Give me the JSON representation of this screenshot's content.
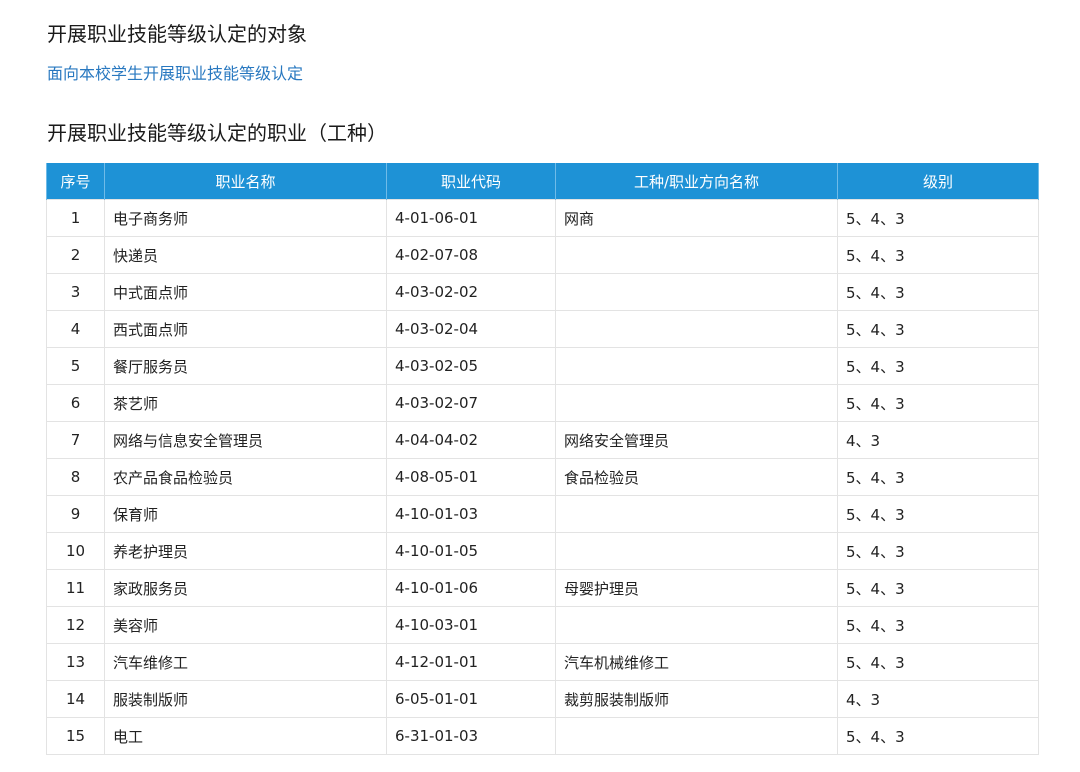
{
  "section1": {
    "title": "开展职业技能等级认定的对象",
    "link_text": "面向本校学生开展职业技能等级认定"
  },
  "section2": {
    "title": "开展职业技能等级认定的职业（工种）"
  },
  "table": {
    "header_bg": "#1e92d6",
    "headers": [
      "序号",
      "职业名称",
      "职业代码",
      "工种/职业方向名称",
      "级别"
    ],
    "rows": [
      [
        "1",
        "电子商务师",
        "4-01-06-01",
        "网商",
        "5、4、3"
      ],
      [
        "2",
        "快递员",
        "4-02-07-08",
        "",
        "5、4、3"
      ],
      [
        "3",
        "中式面点师",
        "4-03-02-02",
        "",
        "5、4、3"
      ],
      [
        "4",
        "西式面点师",
        "4-03-02-04",
        "",
        "5、4、3"
      ],
      [
        "5",
        "餐厅服务员",
        "4-03-02-05",
        "",
        "5、4、3"
      ],
      [
        "6",
        "茶艺师",
        "4-03-02-07",
        "",
        "5、4、3"
      ],
      [
        "7",
        "网络与信息安全管理员",
        "4-04-04-02",
        "网络安全管理员",
        "4、3"
      ],
      [
        "8",
        "农产品食品检验员",
        "4-08-05-01",
        "食品检验员",
        "5、4、3"
      ],
      [
        "9",
        "保育师",
        "4-10-01-03",
        "",
        "5、4、3"
      ],
      [
        "10",
        "养老护理员",
        "4-10-01-05",
        "",
        "5、4、3"
      ],
      [
        "11",
        "家政服务员",
        "4-10-01-06",
        "母婴护理员",
        "5、4、3"
      ],
      [
        "12",
        "美容师",
        "4-10-03-01",
        "",
        "5、4、3"
      ],
      [
        "13",
        "汽车维修工",
        "4-12-01-01",
        "汽车机械维修工",
        "5、4、3"
      ],
      [
        "14",
        "服装制版师",
        "6-05-01-01",
        "裁剪服装制版师",
        "4、3"
      ],
      [
        "15",
        "电工",
        "6-31-01-03",
        "",
        "5、4、3"
      ]
    ]
  }
}
